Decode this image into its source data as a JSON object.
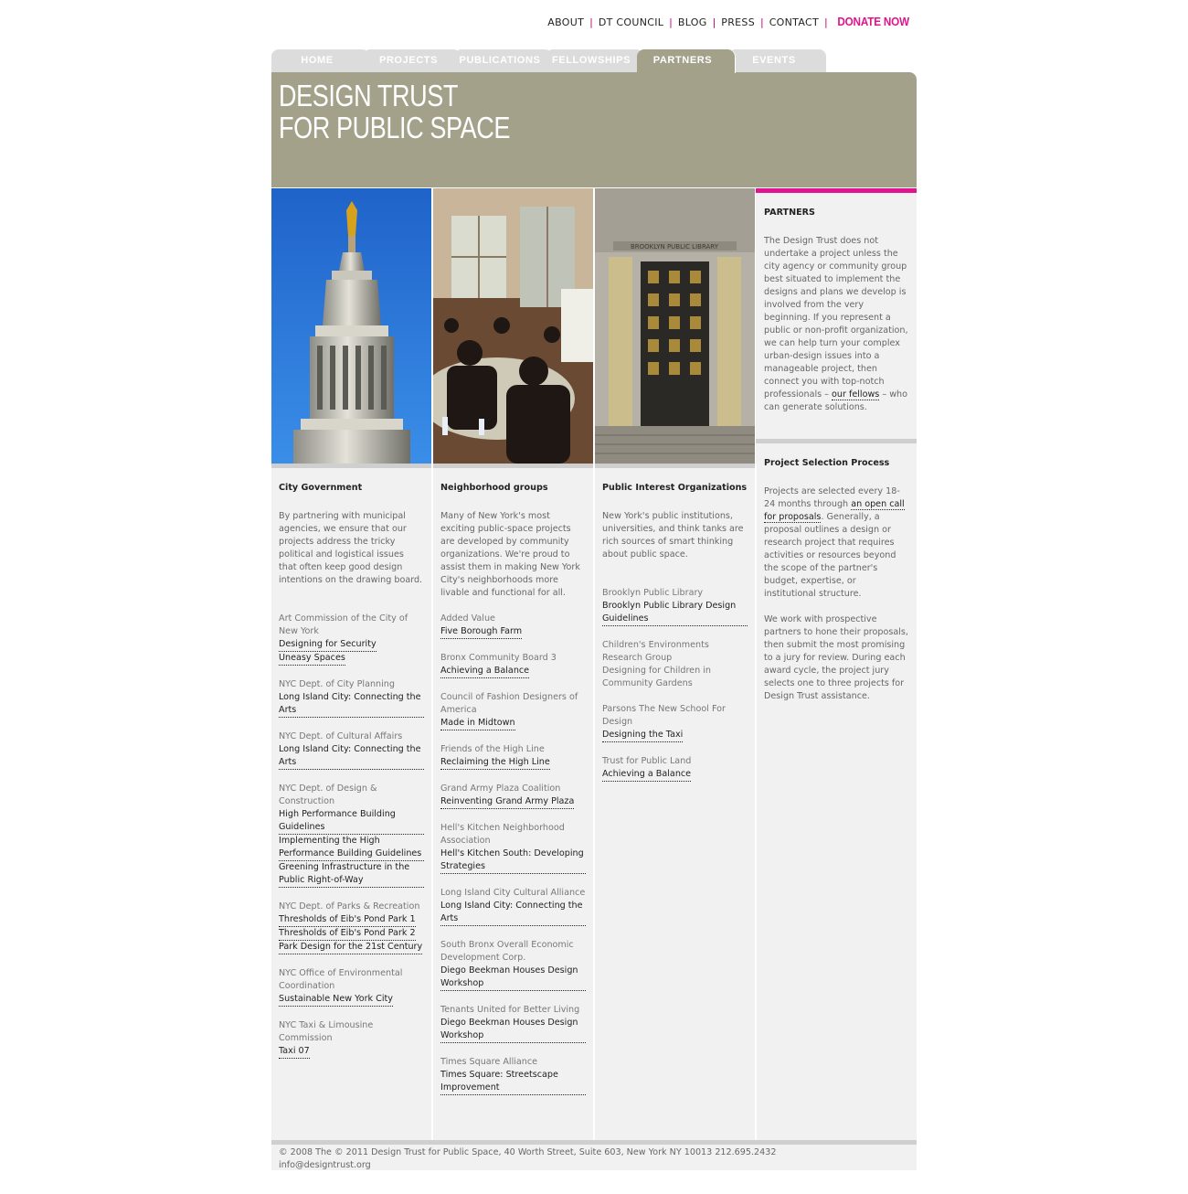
{
  "topnav": {
    "items": [
      "ABOUT",
      "DT COUNCIL",
      "BLOG",
      "PRESS",
      "CONTACT"
    ],
    "separator": "|",
    "donate": "DONATE NOW"
  },
  "tabs": [
    {
      "label": "HOME"
    },
    {
      "label": "PROJECTS"
    },
    {
      "label": "PUBLICATIONS"
    },
    {
      "label": "FELLOWSHIPS"
    },
    {
      "label": "PARTNERS",
      "active": true
    },
    {
      "label": "EVENTS"
    }
  ],
  "brand": {
    "line1": "DESIGN TRUST",
    "line2": "FOR PUBLIC SPACE"
  },
  "photos": {
    "p1_alt": "Municipal Building tower",
    "p2_alt": "Community workshop meeting",
    "p3_alt": "Brooklyn Public Library entrance",
    "library_sign": "BROOKLYN PUBLIC LIBRARY"
  },
  "columns": {
    "city": {
      "title": "City Government",
      "intro": "By partnering with municipal agencies, we ensure that our projects address the tricky political and logistical issues that often keep good design intentions on the drawing board.",
      "entries": [
        {
          "org": "Art Commission of the City of New York",
          "links": [
            "Designing for Security",
            "Uneasy Spaces"
          ]
        },
        {
          "org": "NYC Dept. of City Planning",
          "links": [
            "Long Island City: Connecting the Arts"
          ]
        },
        {
          "org": "NYC Dept. of Cultural Affairs",
          "links": [
            "Long Island City: Connecting the Arts"
          ]
        },
        {
          "org": "NYC Dept. of Design & Construction",
          "links": [
            "High Performance Building Guidelines",
            "Implementing the High Performance Building Guidelines",
            "Greening Infrastructure in the Public Right-of-Way"
          ]
        },
        {
          "org": "NYC Dept. of Parks & Recreation",
          "links": [
            "Thresholds of Eib's Pond Park 1",
            "Thresholds of Eib's Pond Park 2",
            "Park Design for the 21st Century"
          ]
        },
        {
          "org": "NYC Office of Environmental Coordination",
          "links": [
            "Sustainable New York City"
          ]
        },
        {
          "org": "NYC Taxi & Limousine Commission",
          "links": [
            "Taxi 07"
          ]
        }
      ]
    },
    "neighborhood": {
      "title": "Neighborhood groups",
      "intro": "Many of New York's most exciting public-space projects are developed by community organizations. We're proud to assist them in making New York City's neighborhoods more livable and functional for all.",
      "entries": [
        {
          "org": "Added Value",
          "links": [
            "Five Borough Farm"
          ]
        },
        {
          "org": "Bronx Community Board 3",
          "links": [
            "Achieving a Balance"
          ]
        },
        {
          "org": "Council of Fashion Designers of America",
          "links": [
            "Made in Midtown"
          ]
        },
        {
          "org": "Friends of the High Line",
          "links": [
            "Reclaiming the High Line"
          ]
        },
        {
          "org": "Grand Army Plaza Coalition",
          "links": [
            "Reinventing Grand Army Plaza"
          ]
        },
        {
          "org": "Hell's Kitchen Neighborhood Association",
          "links": [
            "Hell's Kitchen South: Developing Strategies"
          ]
        },
        {
          "org": "Long Island City Cultural Alliance",
          "links": [
            "Long Island City: Connecting the Arts"
          ]
        },
        {
          "org": "South Bronx Overall Economic Development Corp.",
          "links": [
            "Diego Beekman Houses Design Workshop"
          ]
        },
        {
          "org": "Tenants United for Better Living",
          "links": [
            "Diego Beekman Houses Design Workshop"
          ]
        },
        {
          "org": "Times Square Alliance",
          "links": [
            "Times Square: Streetscape Improvement"
          ]
        }
      ]
    },
    "public": {
      "title": "Public Interest Organizations",
      "intro": "New York's public institutions, universities, and think tanks are rich sources of smart thinking about public space.",
      "entries": [
        {
          "org": "Brooklyn Public Library",
          "links": [
            "Brooklyn Public Library Design Guidelines"
          ]
        },
        {
          "org": "Children's Environments Research Group",
          "plain": "Designing for Children in Community Gardens",
          "links": []
        },
        {
          "org": "Parsons The New School For Design",
          "links": [
            "Designing the Taxi"
          ]
        },
        {
          "org": "Trust for Public Land",
          "links": [
            "Achieving a Balance"
          ]
        }
      ]
    }
  },
  "sidebar": {
    "partners_title": "PARTNERS",
    "partners_text_1": "The Design Trust does not undertake a project unless the city agency or community group best situated to implement the designs and plans we develop is involved from the very beginning. If you represent a public or non-profit organization, we can help turn your complex urban-design issues into a manageable project, then connect you with top-notch professionals – ",
    "partners_link": "our fellows",
    "partners_text_2": " – who can generate solutions.",
    "process_title": "Project Selection Process",
    "process_text_1": "Projects are selected every 18-24 months through ",
    "process_link": "an open call for proposals",
    "process_text_2": ". Generally, a proposal outlines a design or research project that requires activities or resources beyond the scope of the partner's budget, expertise, or institutional structure.",
    "process_text_3": "We work with prospective partners to hone their proposals, then submit the most promising to a jury for review. During each award cycle, the project jury selects one to three projects for Design Trust assistance."
  },
  "footer": {
    "line1": "© 2008 The © 2011 Design Trust for Public Space, 40 Worth Street, Suite 603, New York NY 10013  212.695.2432",
    "line2": "info@designtrust.org"
  },
  "colors": {
    "accent": "#e0148c",
    "banner": "#a3a18a",
    "column_bg": "#f1f1f1"
  }
}
